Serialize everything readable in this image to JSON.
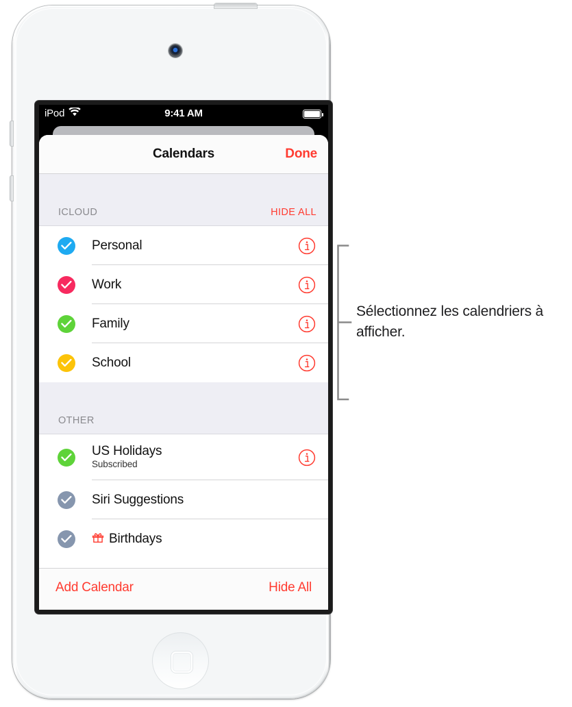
{
  "device": {
    "name": "iPod touch",
    "camera_icon": "front-camera",
    "home_button_icon": "home-button"
  },
  "status_bar": {
    "carrier": "iPod",
    "wifi_icon": "wifi-icon",
    "time": "9:41 AM",
    "battery_icon": "battery-full-icon"
  },
  "sheet": {
    "nav": {
      "title": "Calendars",
      "done_label": "Done"
    },
    "sections": [
      {
        "id": "icloud",
        "header": "ICLOUD",
        "action": "HIDE ALL",
        "rows": [
          {
            "title": "Personal",
            "subtitle": "",
            "color": "#1eaaf1",
            "checked": true,
            "info": true,
            "badge_icon": ""
          },
          {
            "title": "Work",
            "subtitle": "",
            "color": "#f72a5f",
            "checked": true,
            "info": true,
            "badge_icon": ""
          },
          {
            "title": "Family",
            "subtitle": "",
            "color": "#5ed339",
            "checked": true,
            "info": true,
            "badge_icon": ""
          },
          {
            "title": "School",
            "subtitle": "",
            "color": "#fcc309",
            "checked": true,
            "info": true,
            "badge_icon": ""
          }
        ]
      },
      {
        "id": "other",
        "header": "OTHER",
        "action": "",
        "rows": [
          {
            "title": "US Holidays",
            "subtitle": "Subscribed",
            "color": "#5ed339",
            "checked": true,
            "info": true,
            "badge_icon": ""
          },
          {
            "title": "Siri Suggestions",
            "subtitle": "",
            "color": "#8696ae",
            "checked": true,
            "info": false,
            "badge_icon": ""
          },
          {
            "title": "Birthdays",
            "subtitle": "",
            "color": "#8696ae",
            "checked": true,
            "info": false,
            "badge_icon": "gift-icon"
          }
        ]
      }
    ],
    "toolbar": {
      "add_label": "Add Calendar",
      "hide_all_label": "Hide All"
    }
  },
  "callout": {
    "text": "Sélectionnez les calendriers à afficher.",
    "bracket_icon": "callout-bracket"
  },
  "colors": {
    "accent_red": "#ff3b30",
    "separator": "#d4d4d6",
    "section_bg": "#eeeef4",
    "section_label": "#8a8a8e",
    "sheet_bg": "#fbfbfb"
  }
}
